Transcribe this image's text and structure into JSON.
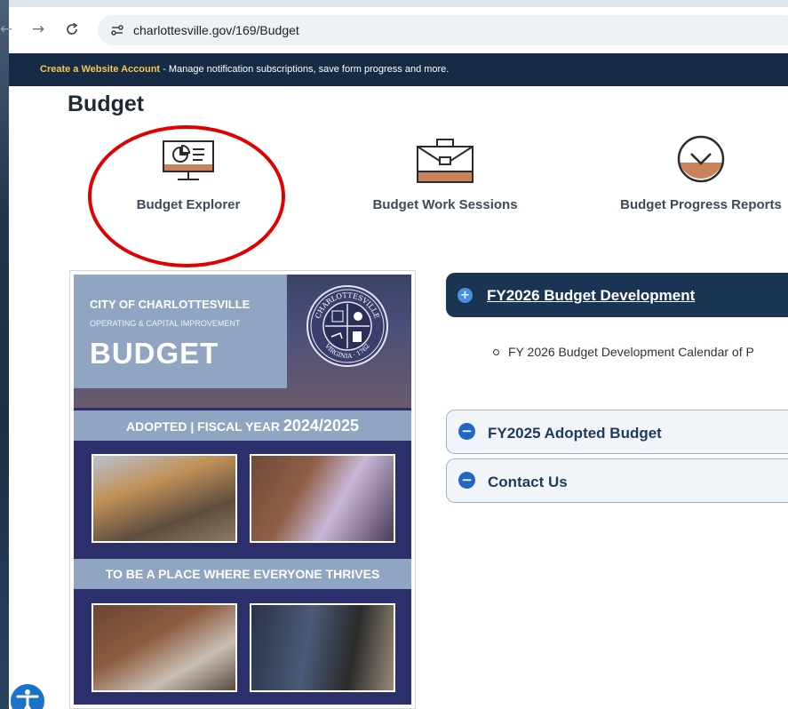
{
  "browser": {
    "url": "charlottesville.gov/169/Budget",
    "back_icon": "←",
    "forward_icon": "→",
    "reload_icon": "C"
  },
  "banner": {
    "link_text": "Create a Website Account",
    "text": " - Manage notification subscriptions, save form progress and more."
  },
  "page": {
    "title": "Budget"
  },
  "quick_links": [
    {
      "label": "Budget Explorer",
      "icon": "computer-chart-icon"
    },
    {
      "label": "Budget Work Sessions",
      "icon": "briefcase-icon"
    },
    {
      "label": "Budget Progress Reports",
      "icon": "chevron-circle-icon"
    }
  ],
  "cover": {
    "city": "CITY OF CHARLOTTESVILLE",
    "subtitle": "OPERATING & CAPITAL IMPROVEMENT",
    "budget": "BUDGET",
    "band1_prefix": "ADOPTED | FISCAL YEAR ",
    "band1_year": "2024/2025",
    "band2": "TO BE A PLACE WHERE EVERYONE THRIVES",
    "seal_top": "CHARLOTTESVILLE",
    "seal_bottom": "VIRGINIA · 1762"
  },
  "accordions": [
    {
      "title": "FY2026 Budget Development",
      "state": "+"
    },
    {
      "title": "FY2025 Adopted Budget",
      "state": "−"
    },
    {
      "title": "Contact Us",
      "state": "−"
    }
  ],
  "accordion_items": [
    "FY 2026 Budget Development Calendar of P"
  ],
  "colors": {
    "banner_bg": "#172b46",
    "banner_link": "#f2c94c",
    "accent_dark": "#1a3454",
    "icon_orange": "#c9825a",
    "highlight_red": "#e10000"
  }
}
